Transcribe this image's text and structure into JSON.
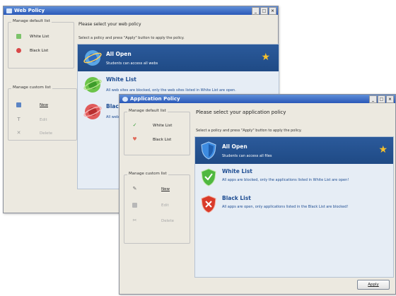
{
  "web_window": {
    "title": "Web Policy",
    "controls": [
      "_",
      "□",
      "×"
    ],
    "default_group": {
      "legend": "Manage default list",
      "items": [
        {
          "label": "White List",
          "icon": "green-square-icon"
        },
        {
          "label": "Black List",
          "icon": "red-circle-icon"
        }
      ]
    },
    "custom_group": {
      "legend": "Manage custom list",
      "items": [
        {
          "label": "New",
          "enabled": true
        },
        {
          "label": "Edit",
          "enabled": false
        },
        {
          "label": "Delete",
          "enabled": false
        }
      ]
    },
    "heading": "Please select your web policy",
    "instruction": "Select a policy and press \"Apply\" button to apply the policy.",
    "policies": [
      {
        "name": "All Open",
        "desc": "Students can access all webs",
        "selected": true
      },
      {
        "name": "White List",
        "desc": "All web sites are blocked, only the web sites listed in White List are open.",
        "selected": false
      },
      {
        "name": "Black List",
        "desc": "All web sites",
        "selected": false
      }
    ]
  },
  "app_window": {
    "title": "Application Policy",
    "controls": [
      "_",
      "□",
      "×"
    ],
    "default_group": {
      "legend": "Manage default list",
      "items": [
        {
          "label": "White List",
          "icon": "checkmark-icon"
        },
        {
          "label": "Black List",
          "icon": "red-heart-icon"
        }
      ]
    },
    "custom_group": {
      "legend": "Manage custom list",
      "items": [
        {
          "label": "New",
          "enabled": true
        },
        {
          "label": "Edit",
          "enabled": false
        },
        {
          "label": "Delete",
          "enabled": false
        }
      ]
    },
    "heading": "Please select your application policy",
    "instruction": "Select a policy and press \"Apply\" button to apply the policy.",
    "policies": [
      {
        "name": "All Open",
        "desc": "Students can access all files",
        "selected": true
      },
      {
        "name": "White List",
        "desc": "All apps are blocked, only the applications listed in White List are open!",
        "selected": false
      },
      {
        "name": "Black List",
        "desc": "All apps are open, only applications listed in the Black List are blocked!",
        "selected": false
      }
    ],
    "apply_label": "Apply"
  },
  "colors": {
    "selected_policy_bg": "#2b5a9b",
    "policy_text": "#1d4c92",
    "title_bar": "#2a58b8",
    "star": "#f7c12b"
  }
}
